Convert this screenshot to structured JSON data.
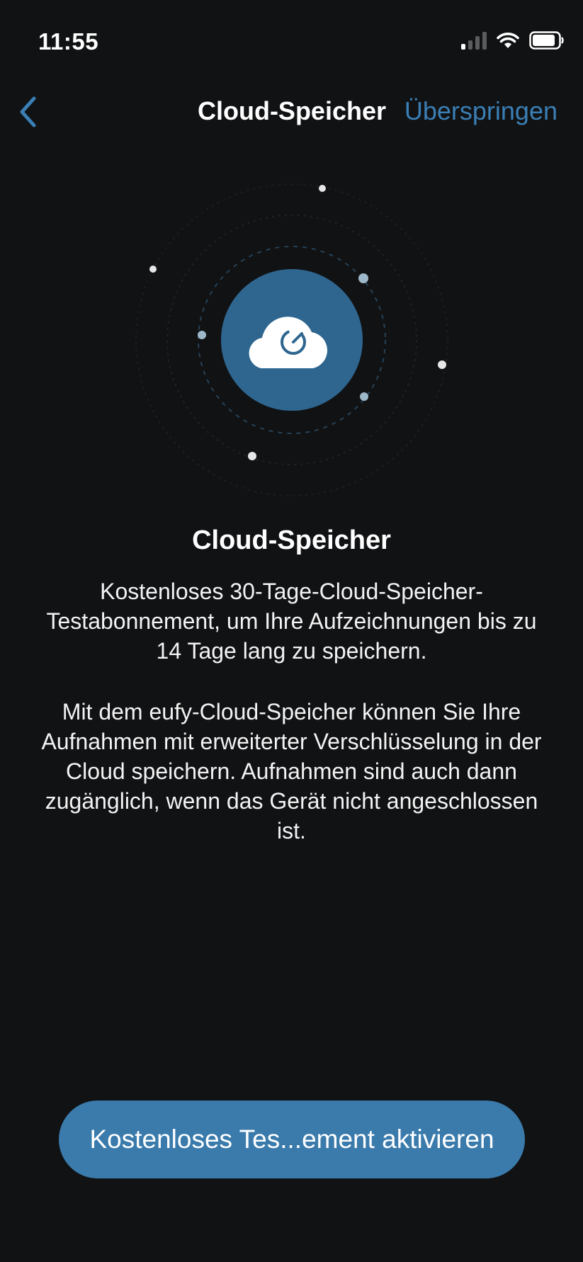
{
  "status_bar": {
    "time": "11:55",
    "icons": [
      "cellular-signal-icon",
      "wifi-icon",
      "battery-icon"
    ]
  },
  "nav": {
    "back_icon": "chevron-left-icon",
    "title": "Cloud-Speicher",
    "skip_label": "Überspringen"
  },
  "illustration": {
    "icon": "cloud-icon"
  },
  "content": {
    "title": "Cloud-Speicher",
    "paragraph1": "Kostenloses 30-Tage-Cloud-Speicher-Testabonnement, um Ihre Aufzeichnungen bis zu 14 Tage lang zu speichern.",
    "paragraph2": "Mit dem eufy-Cloud-Speicher können Sie Ihre Aufnahmen mit erweiterter Verschlüsselung in der Cloud speichern. Aufnahmen sind auch dann zugänglich, wenn das Gerät nicht angeschlossen ist."
  },
  "cta": {
    "label": "Kostenloses Tes...ement aktivieren"
  },
  "colors": {
    "background": "#111214",
    "accent": "#3a7fb5",
    "button": "#3a7bac",
    "circle": "#2e6690"
  }
}
